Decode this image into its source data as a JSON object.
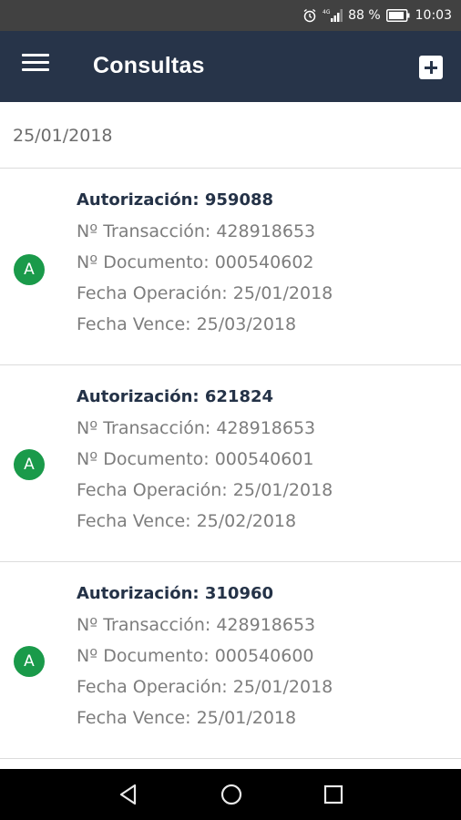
{
  "status_bar": {
    "network": "4G",
    "battery_percent": "88 %",
    "time": "10:03",
    "icons": [
      "alarm-icon",
      "signal-icon",
      "battery-icon"
    ]
  },
  "app_bar": {
    "title": "Consultas",
    "menu_icon": "hamburger-menu-icon",
    "add_icon": "add-box-icon",
    "background_color": "#273449"
  },
  "list": {
    "date": "25/01/2018",
    "records": [
      {
        "status_letter": "A",
        "authorization": "Autorización: 959088",
        "transaction": "Nº Transacción: 428918653",
        "document": "Nº Documento: 000540602",
        "operation_date": "Fecha Operación: 25/01/2018",
        "due_date": "Fecha Vence: 25/03/2018"
      },
      {
        "status_letter": "A",
        "authorization": "Autorización: 621824",
        "transaction": "Nº Transacción: 428918653",
        "document": "Nº Documento: 000540601",
        "operation_date": "Fecha Operación: 25/01/2018",
        "due_date": "Fecha Vence: 25/02/2018"
      },
      {
        "status_letter": "A",
        "authorization": "Autorización: 310960",
        "transaction": "Nº Transacción: 428918653",
        "document": "Nº Documento: 000540600",
        "operation_date": "Fecha Operación: 25/01/2018",
        "due_date": "Fecha Vence: 25/01/2018"
      }
    ],
    "status_color": "#1a9a4a"
  },
  "nav_bar": {
    "icons": [
      "back-triangle-icon",
      "home-circle-icon",
      "recent-apps-square-icon"
    ]
  }
}
